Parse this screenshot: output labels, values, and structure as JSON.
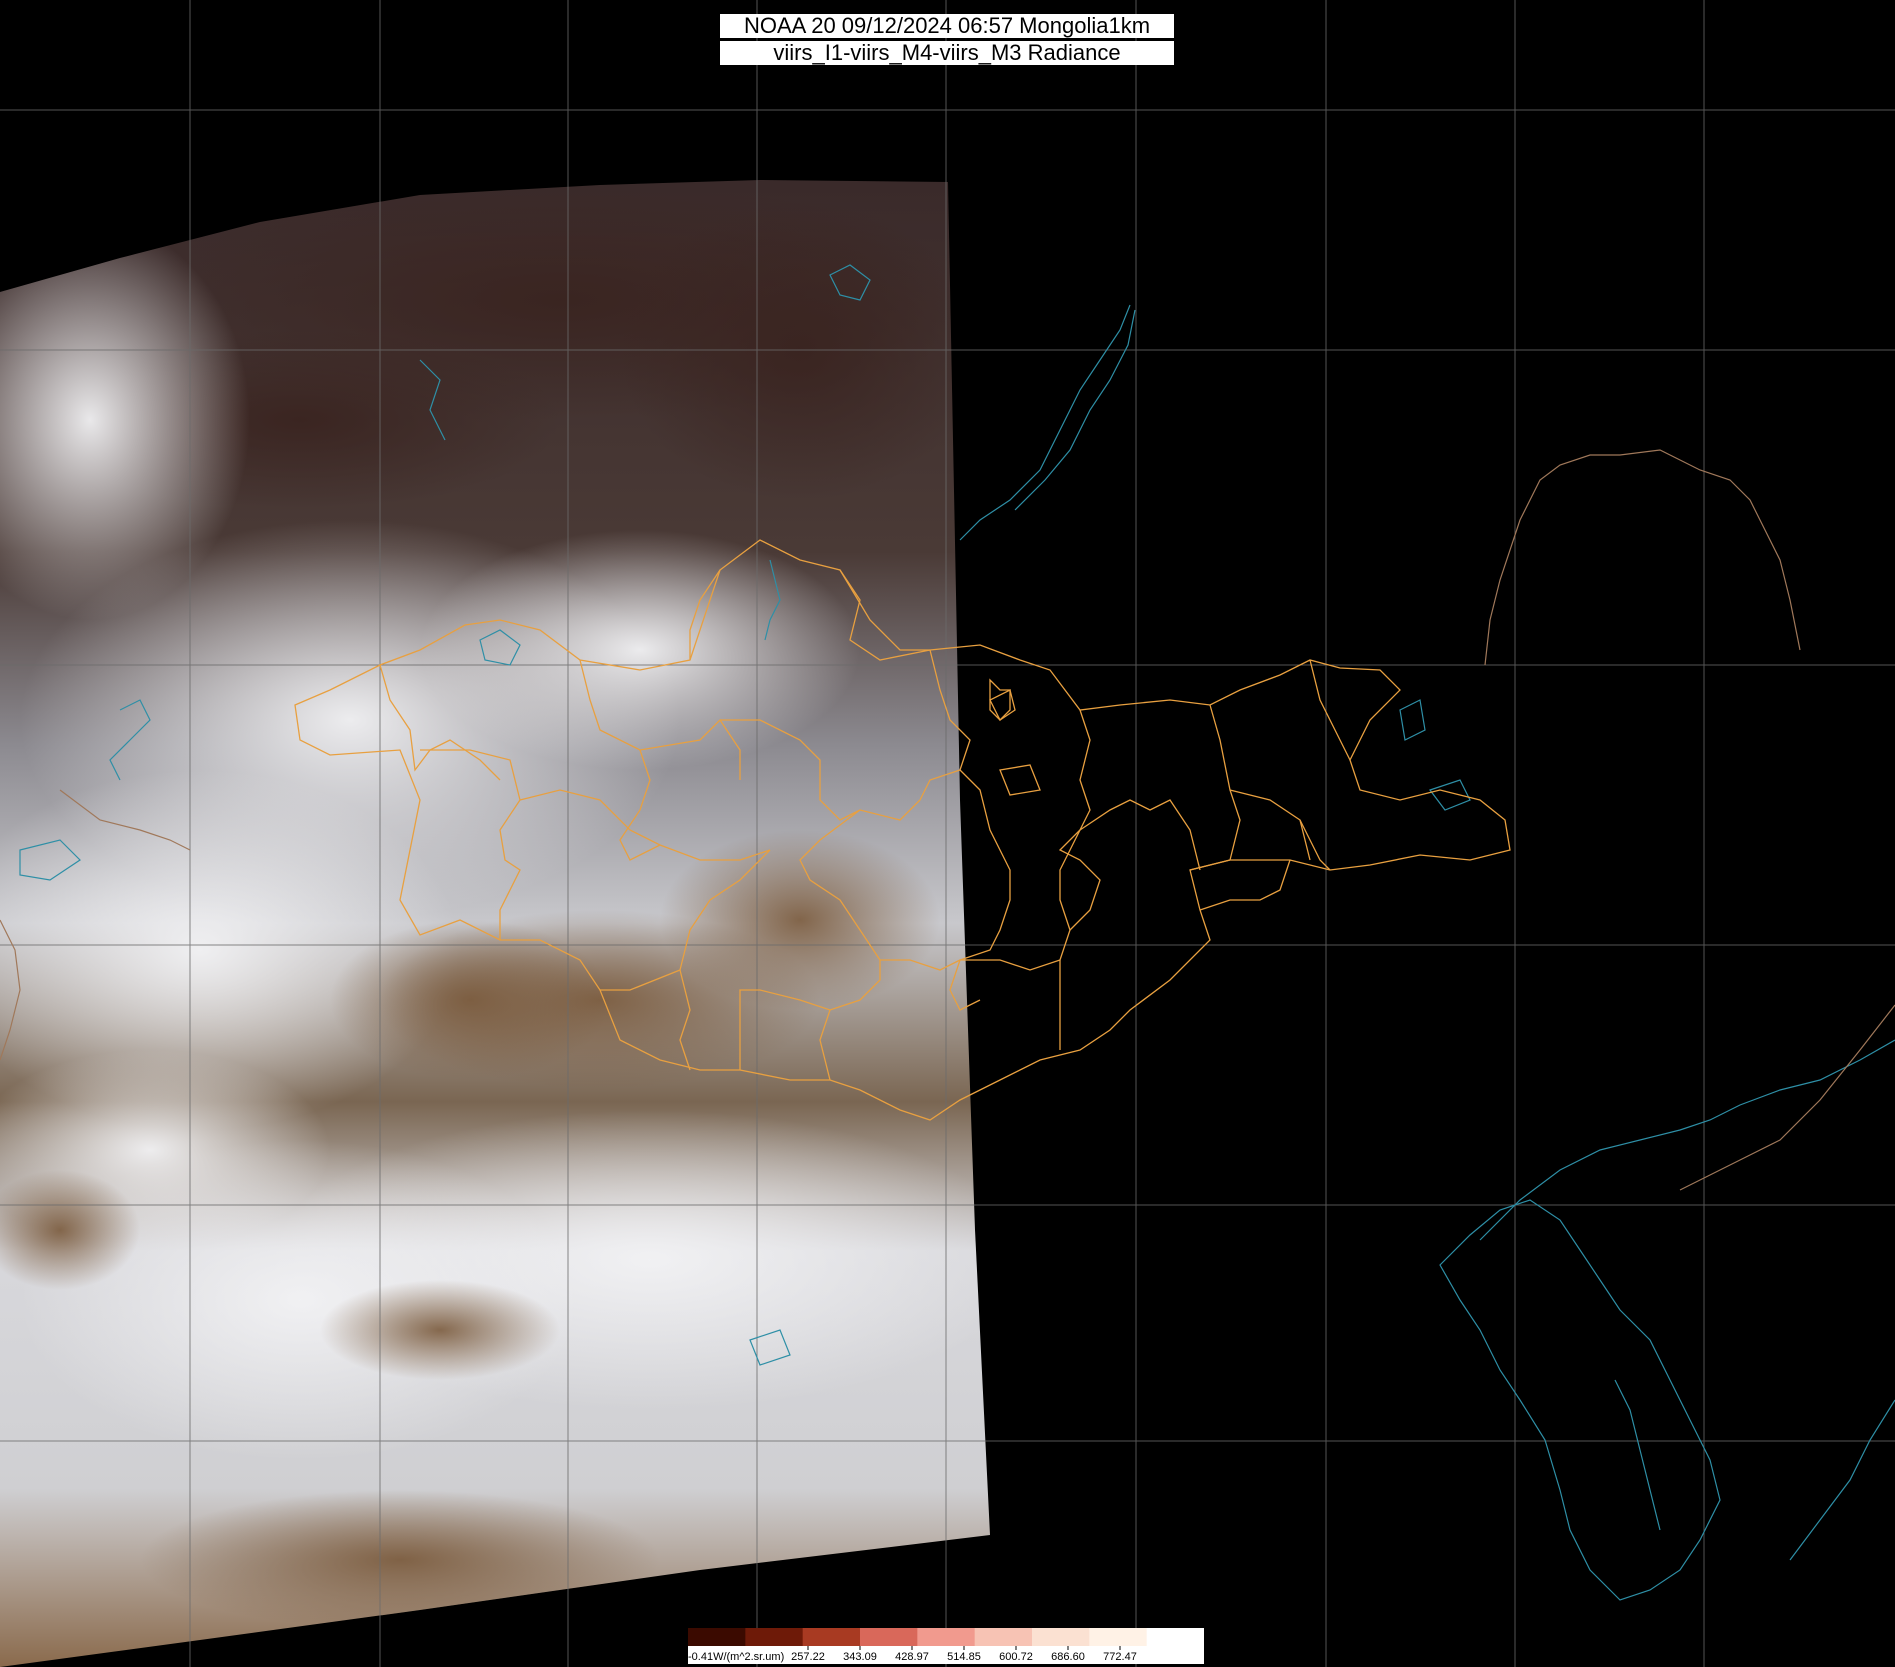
{
  "title": {
    "line1": "NOAA 20 09/12/2024 06:57 Mongolia1km",
    "line2": "viirs_I1-viirs_M4-viirs_M3 Radiance"
  },
  "colorbar": {
    "unit_label": "-0.41W/(m^2.sr.um)",
    "ticks": [
      "257.22",
      "343.09",
      "428.97",
      "514.85",
      "600.72",
      "686.60",
      "772.47"
    ],
    "swatches": [
      "#3b0a00",
      "#6e1a08",
      "#a83a22",
      "#d9685a",
      "#f19a8e",
      "#f7c3b4",
      "#fbe1d2",
      "#fff2e6",
      "#ffffff"
    ]
  },
  "colors": {
    "background": "#000000",
    "province_border": "#e8a040",
    "coastline": "#2e8fa6",
    "national_border": "#a0785a",
    "graticule": "#6a6a6a"
  }
}
